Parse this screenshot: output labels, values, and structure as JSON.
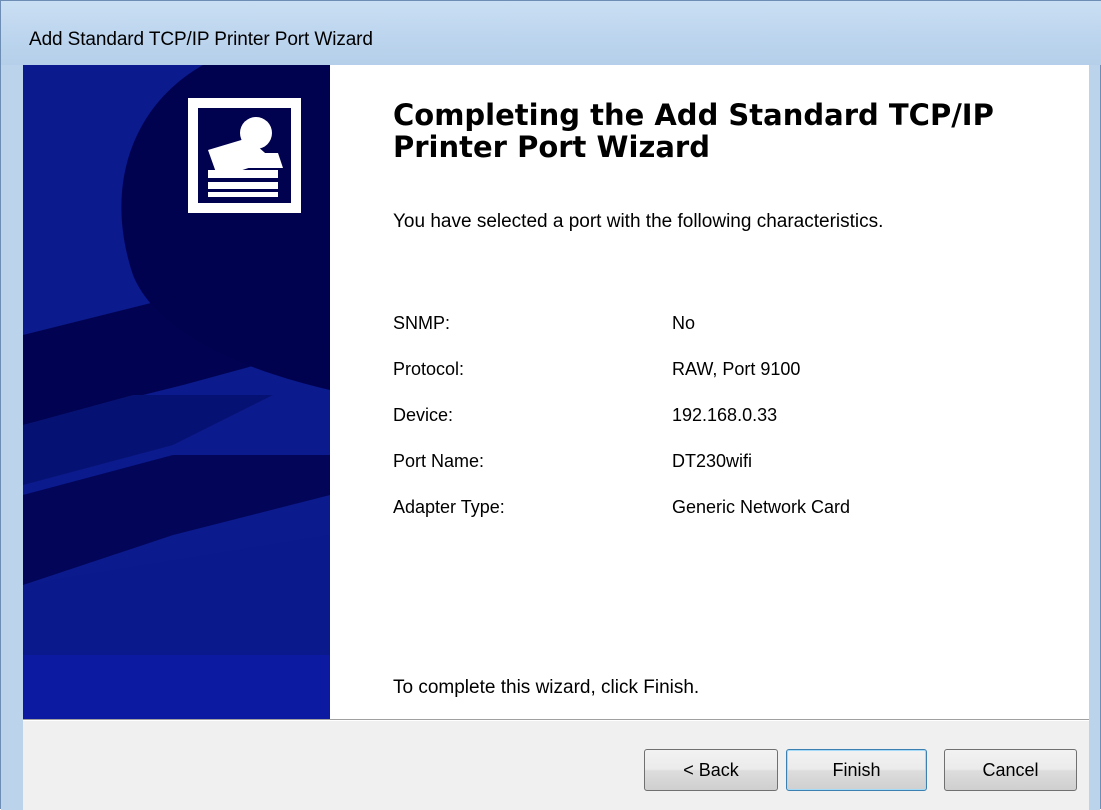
{
  "window": {
    "title": "Add Standard TCP/IP Printer Port Wizard"
  },
  "page": {
    "heading": "Completing the Add Standard TCP/IP Printer Port Wizard",
    "intro": "You have selected a port with the following characteristics.",
    "details": [
      {
        "label": "SNMP:",
        "value": "No"
      },
      {
        "label": "Protocol:",
        "value": "RAW, Port 9100"
      },
      {
        "label": "Device:",
        "value": "192.168.0.33"
      },
      {
        "label": "Port Name:",
        "value": "DT230wifi"
      },
      {
        "label": "Adapter Type:",
        "value": "Generic Network Card"
      }
    ],
    "instruction": "To complete this wizard, click Finish."
  },
  "buttons": {
    "back": "< Back",
    "finish": "Finish",
    "cancel": "Cancel"
  },
  "colors": {
    "banner": "#01024f",
    "banner_shape": "#0b1a8c",
    "titlebar": "#c3d9ee"
  },
  "icons": {
    "wizard": "printer-wizard-icon"
  }
}
